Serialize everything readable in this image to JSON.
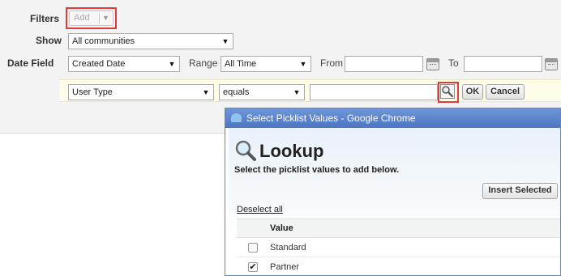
{
  "filters": {
    "label": "Filters",
    "add_button": "Add",
    "show_label": "Show",
    "show_value": "All communities",
    "date_field_label": "Date Field",
    "date_field_value": "Created Date",
    "range_label": "Range",
    "range_value": "All Time",
    "from_label": "From",
    "to_label": "To",
    "criteria": {
      "field": "User Type",
      "operator": "equals",
      "value": "",
      "ok_button": "OK",
      "cancel_button": "Cancel"
    }
  },
  "popup": {
    "window_title": "Select Picklist Values - Google Chrome",
    "title": "Lookup",
    "subtitle": "Select the picklist values to add below.",
    "insert_button": "Insert Selected",
    "deselect_link": "Deselect all",
    "column_header": "Value",
    "rows": [
      {
        "value": "Standard",
        "checked": false
      },
      {
        "value": "Partner",
        "checked": true
      }
    ]
  },
  "colors": {
    "highlight": "#e03a3a",
    "titlebar": "#4b76c2",
    "criteria_row": "#fefbe8"
  }
}
